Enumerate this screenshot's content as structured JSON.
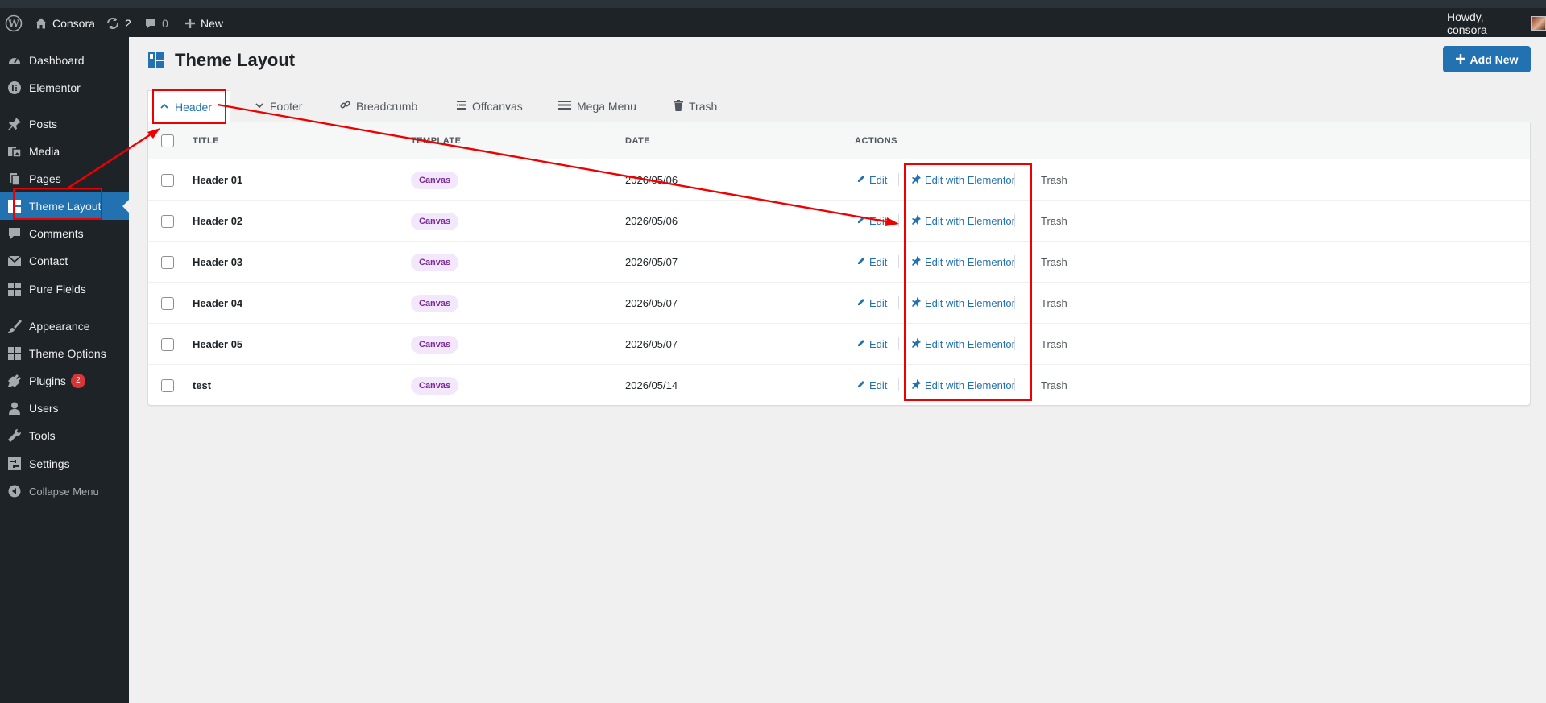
{
  "adminbar": {
    "site_name": "Consora",
    "updates_count": "2",
    "comments_count": "0",
    "new_label": "New",
    "howdy": "Howdy, consora"
  },
  "sidebar": {
    "items": [
      {
        "label": "Dashboard",
        "icon": "dashboard-icon"
      },
      {
        "label": "Elementor",
        "icon": "elementor-icon"
      },
      {
        "label": "Posts",
        "icon": "pin-icon"
      },
      {
        "label": "Media",
        "icon": "media-icon"
      },
      {
        "label": "Pages",
        "icon": "pages-icon"
      },
      {
        "label": "Theme Layout",
        "icon": "layout-icon",
        "current": true
      },
      {
        "label": "Comments",
        "icon": "comment-icon"
      },
      {
        "label": "Contact",
        "icon": "mail-icon"
      },
      {
        "label": "Pure Fields",
        "icon": "grid-icon"
      },
      {
        "label": "Appearance",
        "icon": "brush-icon"
      },
      {
        "label": "Theme Options",
        "icon": "grid-icon"
      },
      {
        "label": "Plugins",
        "icon": "plugin-icon",
        "badge": "2"
      },
      {
        "label": "Users",
        "icon": "user-icon"
      },
      {
        "label": "Tools",
        "icon": "wrench-icon"
      },
      {
        "label": "Settings",
        "icon": "settings-icon"
      },
      {
        "label": "Collapse Menu",
        "icon": "collapse-icon"
      }
    ]
  },
  "page": {
    "title": "Theme Layout",
    "add_new": "Add New"
  },
  "tabs": [
    {
      "label": "Header",
      "icon": "chevron-up-icon",
      "active": true
    },
    {
      "label": "Footer",
      "icon": "chevron-down-icon"
    },
    {
      "label": "Breadcrumb",
      "icon": "link-icon"
    },
    {
      "label": "Offcanvas",
      "icon": "offcanvas-icon"
    },
    {
      "label": "Mega Menu",
      "icon": "menu-icon"
    },
    {
      "label": "Trash",
      "icon": "trash-icon"
    }
  ],
  "table": {
    "columns": [
      "TITLE",
      "TEMPLATE",
      "DATE",
      "ACTIONS"
    ],
    "action_labels": {
      "edit": "Edit",
      "elementor": "Edit with Elementor",
      "trash": "Trash"
    },
    "rows": [
      {
        "title": "Header 01",
        "template": "Canvas",
        "date": "2026/05/06"
      },
      {
        "title": "Header 02",
        "template": "Canvas",
        "date": "2026/05/06"
      },
      {
        "title": "Header 03",
        "template": "Canvas",
        "date": "2026/05/07"
      },
      {
        "title": "Header 04",
        "template": "Canvas",
        "date": "2026/05/07"
      },
      {
        "title": "Header 05",
        "template": "Canvas",
        "date": "2026/05/07"
      },
      {
        "title": "test",
        "template": "Canvas",
        "date": "2026/05/14"
      }
    ]
  },
  "colors": {
    "accent": "#2271b1",
    "sidebar_bg": "#1d2327",
    "annotation": "#e00000",
    "badge": "#d63638"
  }
}
